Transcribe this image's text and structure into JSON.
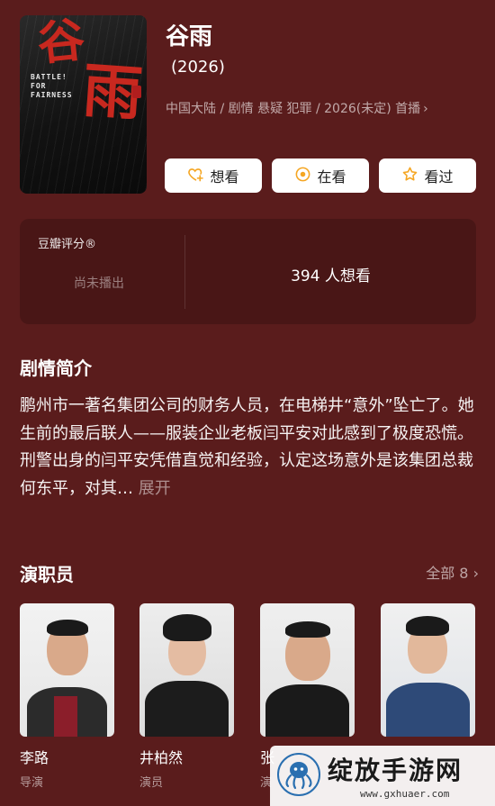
{
  "poster": {
    "title_chars": [
      "谷",
      "雨"
    ],
    "english_title": "BATTLE! FOR FAIRNESS"
  },
  "header": {
    "title": "谷雨",
    "year": "(2026)",
    "meta": "中国大陆 / 剧情 悬疑 犯罪 / 2026(未定) 首播",
    "meta_chevron": "›"
  },
  "actions": {
    "want_label": "想看",
    "watching_label": "在看",
    "watched_label": "看过",
    "accent_color": "#f5a623"
  },
  "rating": {
    "title": "豆瓣评分®",
    "status": "尚未播出",
    "want_count": "394 人想看"
  },
  "synopsis": {
    "title": "剧情简介",
    "text": "鹏州市一著名集团公司的财务人员，在电梯井“意外”坠亡了。她生前的最后联人——服装企业老板闫平安对此感到了极度恐慌。刑警出身的闫平安凭借直觉和经验，认定这场意外是该集团总裁何东平，对其…",
    "expand_label": "展开"
  },
  "cast": {
    "title": "演职员",
    "all_label": "全部 8",
    "all_chevron": "›",
    "members": [
      {
        "name": "李路",
        "role": "导演"
      },
      {
        "name": "井柏然",
        "role": "演员"
      },
      {
        "name": "张",
        "role": "演"
      },
      {
        "name": "",
        "role": ""
      }
    ]
  },
  "watermark": {
    "text": "绽放手游网",
    "url": "www.gxhuaer.com"
  },
  "colors": {
    "background": "#5a1c1c",
    "card": "#ffffff",
    "poster_red": "#c8281f"
  }
}
